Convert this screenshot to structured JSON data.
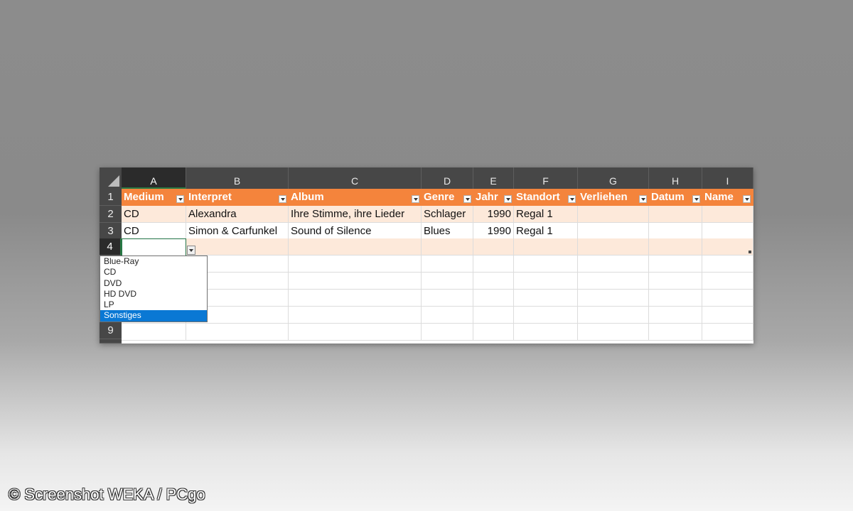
{
  "columns": [
    "A",
    "B",
    "C",
    "D",
    "E",
    "F",
    "G",
    "H",
    "I"
  ],
  "row_numbers": [
    "1",
    "2",
    "3",
    "4",
    "9"
  ],
  "header_row": [
    "Medium",
    "Interpret",
    "Album",
    "Genre",
    "Jahr",
    "Standort",
    "Verliehen",
    "Datum",
    "Name"
  ],
  "rows": [
    [
      "CD",
      "Alexandra",
      "Ihre Stimme, ihre Lieder",
      "Schlager",
      "1990",
      "Regal 1",
      "",
      "",
      ""
    ],
    [
      "CD",
      "Simon & Carfunkel",
      "Sound of Silence",
      "Blues",
      "1990",
      "Regal 1",
      "",
      "",
      ""
    ]
  ],
  "dropdown": {
    "options": [
      "Blue-Ray",
      "CD",
      "DVD",
      "HD DVD",
      "LP",
      "Sonstiges"
    ],
    "highlighted": "Sonstiges"
  },
  "selected_cell": "A4",
  "credit": "© Screenshot WEKA / PCgo",
  "colors": {
    "header_fill": "#f4843c",
    "band_fill": "#fde9da",
    "selection_green": "#217346",
    "highlight_blue": "#0a78d4"
  }
}
